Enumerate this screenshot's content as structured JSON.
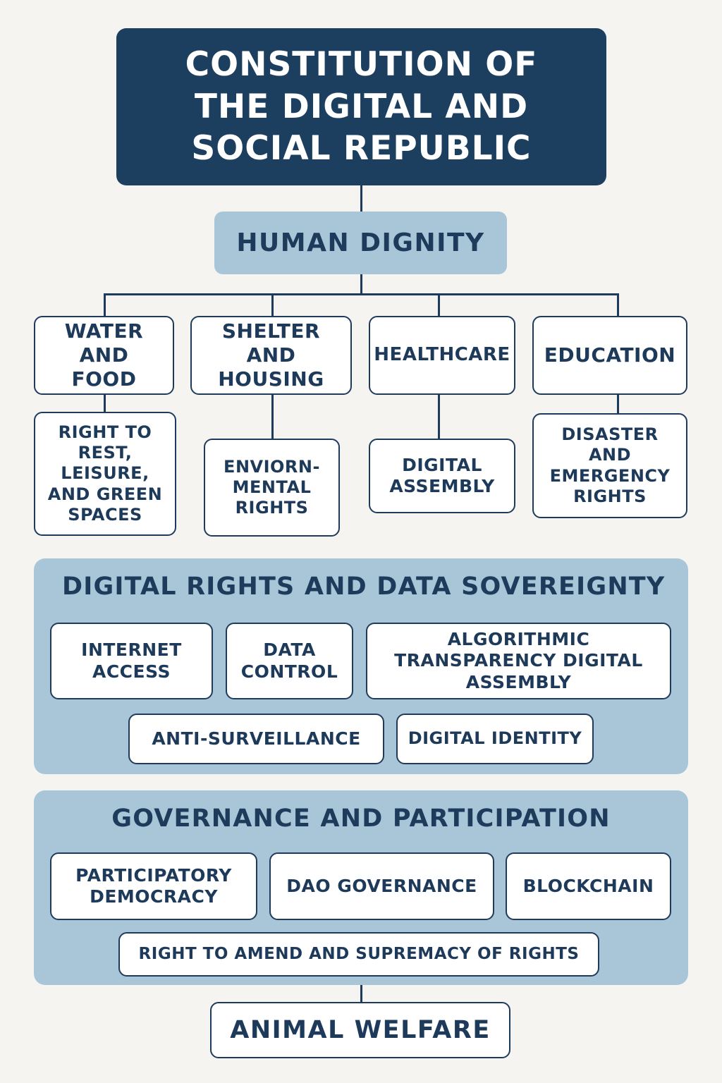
{
  "title": "CONSTITUTION OF THE DIGITAL AND SOCIAL REPUBLIC",
  "root": "HUMAN DIGNITY",
  "pillars": [
    {
      "label": "WATER AND FOOD",
      "child": "RIGHT TO REST, LEISURE, AND GREEN SPACES"
    },
    {
      "label": "SHELTER AND HOUSING",
      "child": "ENVIORN- MENTAL RIGHTS"
    },
    {
      "label": "HEALTHCARE",
      "child": "DIGITAL ASSEMBLY"
    },
    {
      "label": "EDUCATION",
      "child": "DISASTER AND EMERGENCY RIGHTS"
    }
  ],
  "digital_rights": {
    "title": "DIGITAL RIGHTS AND DATA SOVEREIGNTY",
    "items": [
      "INTERNET ACCESS",
      "DATA CONTROL",
      "ALGORITHMIC TRANSPARENCY DIGITAL ASSEMBLY",
      "ANTI-SURVEILLANCE",
      "DIGITAL IDENTITY"
    ]
  },
  "governance": {
    "title": "GOVERNANCE AND PARTICIPATION",
    "items": [
      "PARTICIPATORY DEMOCRACY",
      "DAO GOVERNANCE",
      "BLOCKCHAIN",
      "RIGHT TO AMEND AND SUPREMACY OF RIGHTS"
    ]
  },
  "footer": "ANIMAL WELFARE",
  "colors": {
    "navy": "#1d3f5f",
    "light_blue": "#a9c6d9",
    "background": "#f5f4f1"
  }
}
